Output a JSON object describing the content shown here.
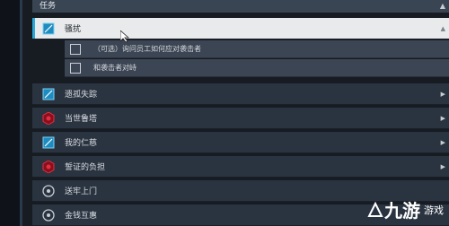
{
  "section": {
    "title": "任务"
  },
  "tasks": [
    {
      "label": "骚扰",
      "icon": "mission-square-icon",
      "selected": true
    },
    {
      "label": "遗孤失踪",
      "icon": "mission-square-icon",
      "selected": false
    },
    {
      "label": "当世鲁塔",
      "icon": "red-hexagon-icon",
      "selected": false
    },
    {
      "label": "我的仁慈",
      "icon": "mission-square-icon",
      "selected": false
    },
    {
      "label": "誓证的负担",
      "icon": "red-hexagon-icon",
      "selected": false
    },
    {
      "label": "送牢上门",
      "icon": "circle-emblem-icon",
      "selected": false
    },
    {
      "label": "金钱互惠",
      "icon": "circle-emblem-icon",
      "selected": false
    }
  ],
  "subtasks": [
    {
      "label": "（可选）询问员工如何应对袭击者"
    },
    {
      "label": "和袭击者对峙"
    }
  ],
  "watermark": {
    "text": "九游",
    "sub": "游戏"
  },
  "colors": {
    "accent": "#2aa8d8",
    "danger": "#c8102e",
    "panel": "#2a3340"
  }
}
